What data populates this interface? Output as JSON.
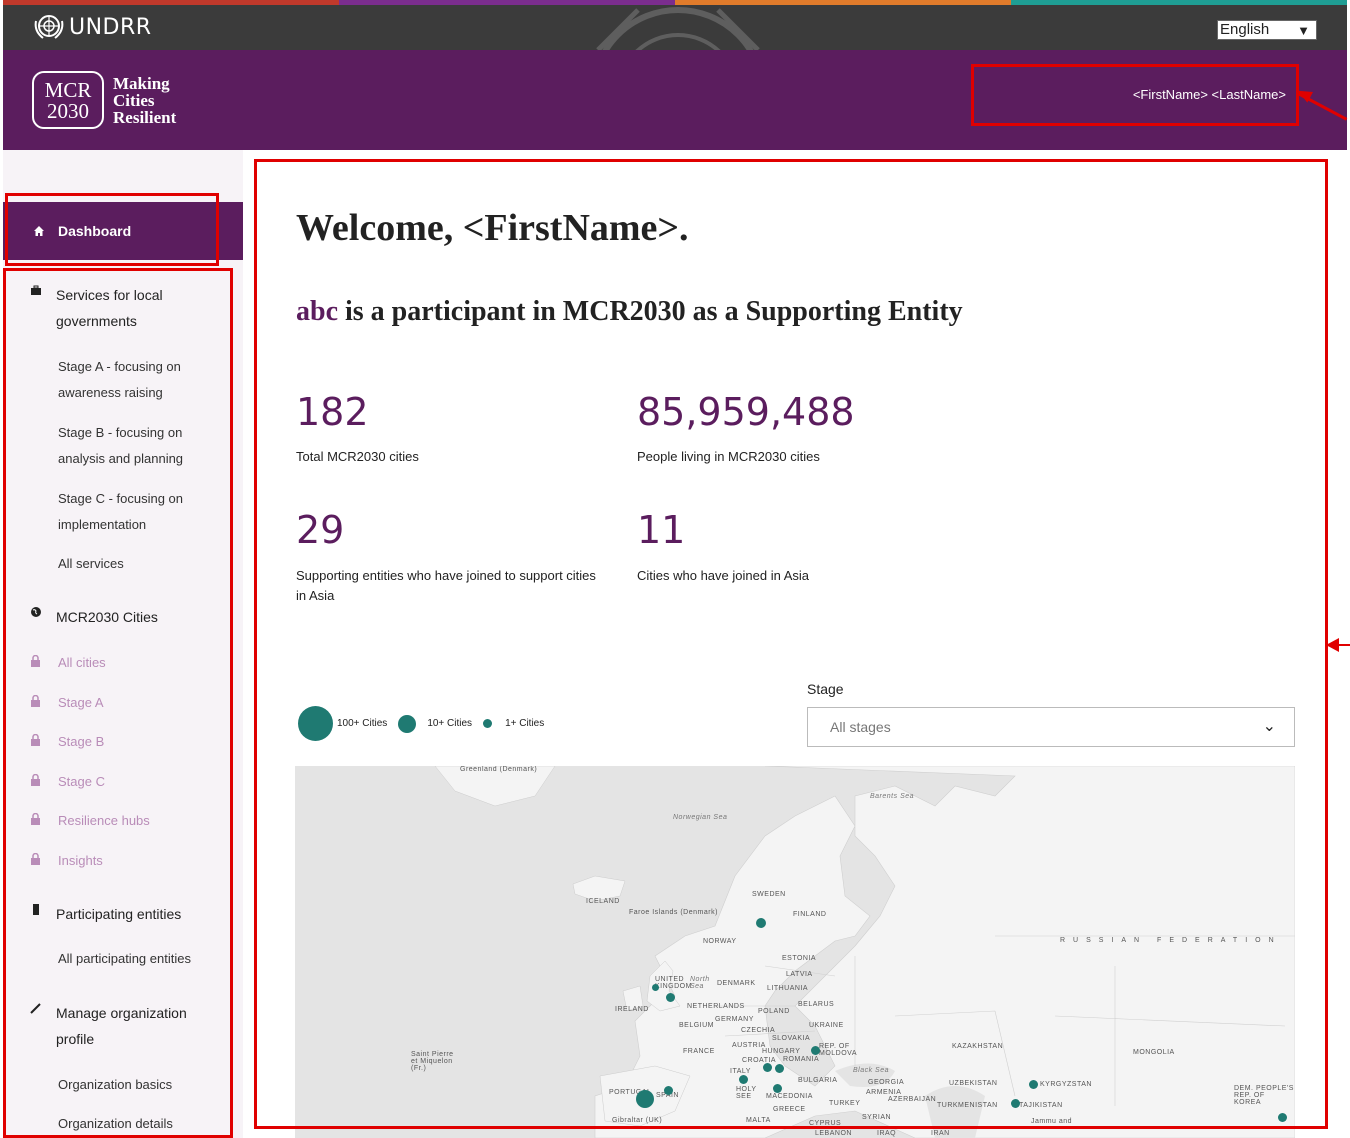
{
  "topbar": {
    "brand": "UNDRR",
    "language": "English"
  },
  "header": {
    "badge_line1": "MCR",
    "badge_line2": "2030",
    "title_line1": "Making",
    "title_line2": "Cities",
    "title_line3": "Resilient",
    "user": "<FirstName> <LastName>"
  },
  "sidebar": {
    "dashboard": "Dashboard",
    "services": {
      "label": "Services for local governments",
      "items": [
        "Stage A - focusing on awareness raising",
        "Stage B - focusing on analysis and planning",
        "Stage C - focusing on implementation",
        "All services"
      ]
    },
    "cities": {
      "label": "MCR2030 Cities",
      "items": [
        "All cities",
        "Stage A",
        "Stage B",
        "Stage C",
        "Resilience hubs",
        "Insights"
      ]
    },
    "entities": {
      "label": "Participating entities",
      "items": [
        "All participating entities"
      ]
    },
    "manage": {
      "label": "Manage organization profile",
      "items": [
        "Organization basics",
        "Organization details"
      ]
    }
  },
  "main": {
    "welcome": "Welcome, <FirstName>.",
    "participant_org": "abc",
    "participant_text": " is a participant in MCR2030 as a Supporting Entity",
    "stats": [
      {
        "value": "182",
        "label": "Total MCR2030 cities"
      },
      {
        "value": "85,959,488",
        "label": "People living in MCR2030 cities"
      },
      {
        "value": "29",
        "label": "Supporting entities who have joined to support cities in Asia"
      },
      {
        "value": "11",
        "label": "Cities who have joined in Asia"
      }
    ],
    "legend": [
      "100+ Cities",
      "10+ Cities",
      "1+ Cities"
    ],
    "stage_label": "Stage",
    "stage_value": "All stages"
  },
  "map": {
    "labels": [
      "Greenland (Denmark)",
      "Norwegian Sea",
      "Barents Sea",
      "ICELAND",
      "Faroe Islands (Denmark)",
      "SWEDEN",
      "FINLAND",
      "NORWAY",
      "ESTONIA",
      "LATVIA",
      "LITHUANIA",
      "DENMARK",
      "UNITED KINGDOM",
      "North Sea",
      "IRELAND",
      "NETHERLANDS",
      "BELARUS",
      "POLAND",
      "GERMANY",
      "BELGIUM",
      "CZECHIA",
      "SLOVAKIA",
      "UKRAINE",
      "AUSTRIA",
      "HUNGARY",
      "REP. OF MOLDOVA",
      "FRANCE",
      "CROATIA",
      "ROMANIA",
      "Black Sea",
      "BULGARIA",
      "ITALY",
      "GEORGIA",
      "ARMENIA",
      "AZERBAIJAN",
      "KAZAKHSTAN",
      "MONGOLIA",
      "UZBEKISTAN",
      "KYRGYZSTAN",
      "TURKMENISTAN",
      "TAJIKISTAN",
      "TURKEY",
      "SYRIAN",
      "GREECE",
      "HOLY SEE",
      "MACEDONIA",
      "SPAIN",
      "PORTUGAL",
      "Gibraltar (UK)",
      "MALTA",
      "CYPRUS",
      "LEBANON",
      "IRAQ",
      "IRAN",
      "DEM. PEOPLE'S REP. OF KOREA",
      "Saint Pierre et Miquelon (Fr.)",
      "RUSSIAN FEDERATION",
      "Jammu and"
    ]
  }
}
